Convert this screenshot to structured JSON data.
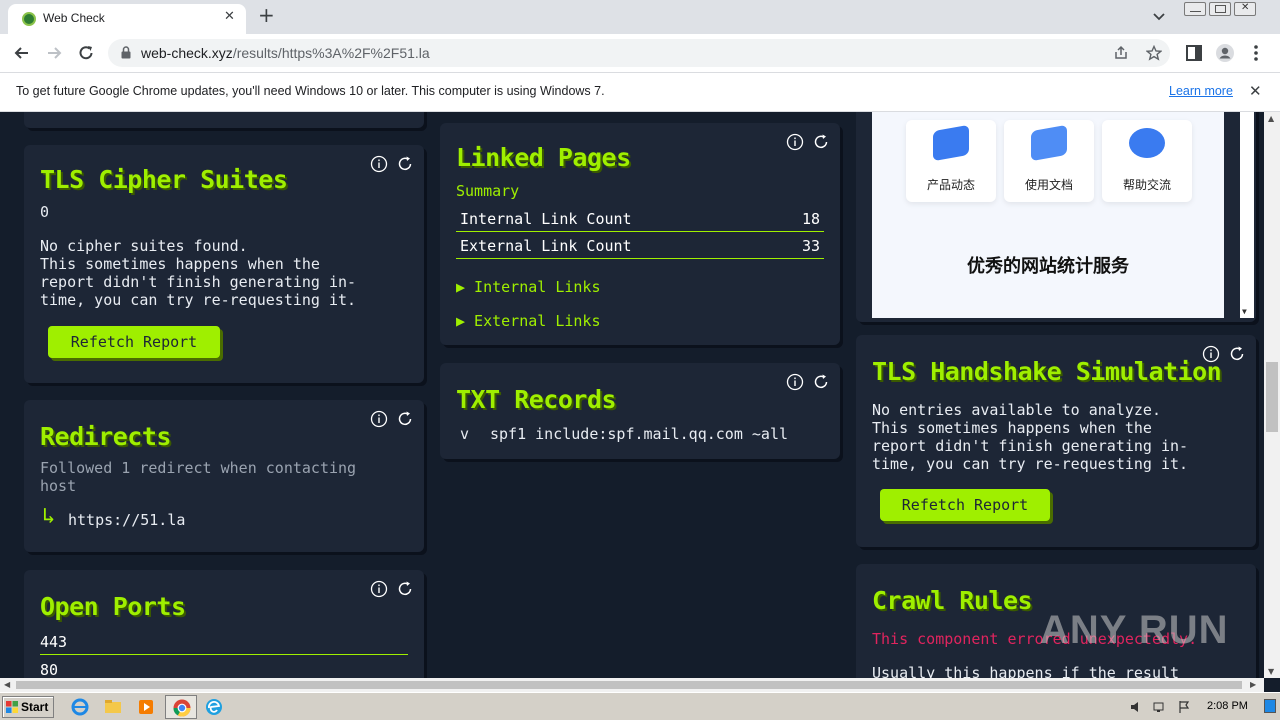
{
  "browser": {
    "tab_title": "Web Check",
    "tab_close": "✕",
    "new_tab": "+",
    "url_host": "web-check.xyz",
    "url_path": "/results/https%3A%2F%2F51.la"
  },
  "infobar": {
    "message": "To get future Google Chrome updates, you'll need Windows 10 or later. This computer is using Windows 7.",
    "link": "Learn more",
    "close": "✕"
  },
  "cards": {
    "tls_cipher": {
      "title": "TLS Cipher Suites",
      "count": "0",
      "message": "No cipher suites found.\nThis sometimes happens when the\nreport didn't finish generating in-\ntime, you can try re-requesting it.",
      "button": "Refetch Report"
    },
    "redirects": {
      "title": "Redirects",
      "summary": "Followed 1 redirect when contacting\nhost",
      "arrow": "↳",
      "url": "https://51.la"
    },
    "open_ports": {
      "title": "Open Ports",
      "ports": [
        "443",
        "80"
      ]
    },
    "linked_pages": {
      "title": "Linked Pages",
      "subtitle": "Summary",
      "rows": [
        {
          "label": "Internal Link Count",
          "value": "18"
        },
        {
          "label": "External Link Count",
          "value": "33"
        }
      ],
      "internal_toggle": "▶ Internal Links",
      "external_toggle": "▶ External Links"
    },
    "txt_records": {
      "title": "TXT Records",
      "key": "v",
      "value": "spf1 include:spf.mail.qq.com ~all"
    },
    "screenshot": {
      "items": [
        "产品动态",
        "使用文档",
        "帮助交流"
      ],
      "tagline": "优秀的网站统计服务"
    },
    "tls_handshake": {
      "title": "TLS Handshake Simulation",
      "message": "No entries available to analyze.\nThis sometimes happens when the\nreport didn't finish generating in-\ntime, you can try re-requesting it.",
      "button": "Refetch Report"
    },
    "crawl_rules": {
      "title": "Crawl Rules",
      "error": "This component errored unexpectedly.",
      "note": "Usually this happens if the result"
    }
  },
  "taskbar": {
    "start": "Start",
    "clock": "2:08 PM"
  },
  "watermark": "ANY RUN",
  "colors": {
    "accent": "#9fef00",
    "card_bg": "#1d2636",
    "page_bg": "#141d2b",
    "error": "#e0245e"
  }
}
